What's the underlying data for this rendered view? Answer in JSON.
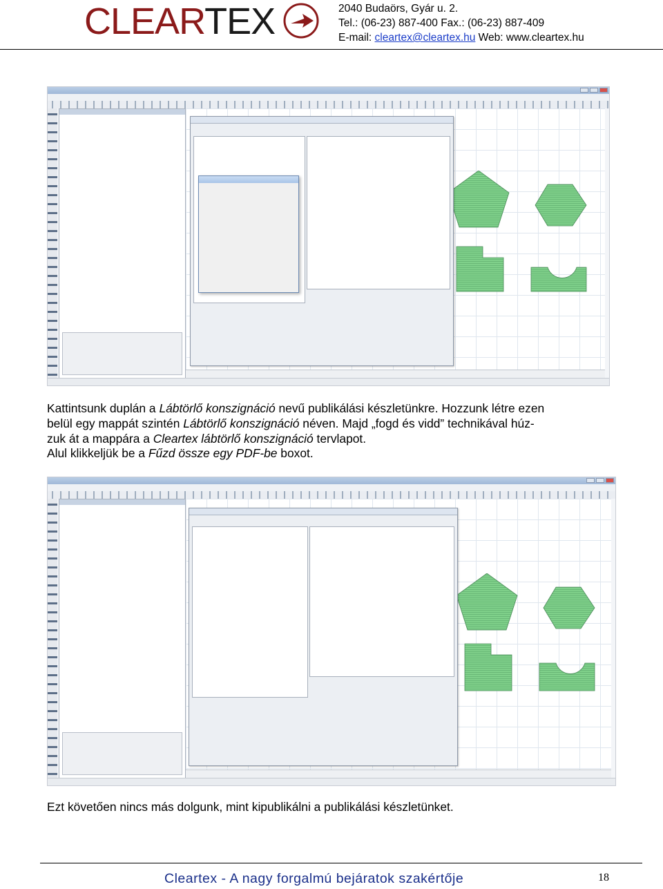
{
  "header": {
    "logo_left": "CLEAR",
    "logo_right": "TEX",
    "address": "2040 Budaörs, Gyár u. 2.",
    "phone": "Tel.: (06-23) 887-400  Fax.: (06-23) 887-409",
    "email_label": "E-mail: ",
    "email": "cleartex@cleartex.hu",
    "web": " Web: www.cleartex.hu",
    "colors": {
      "brand_red": "#8b1a1a",
      "link_blue": "#1a3cc8"
    }
  },
  "paragraph1": {
    "l1_a": "Kattintsunk duplán a ",
    "l1_b": "Lábtörlő konszignáció",
    "l1_c": " nevű publikálási készletünkre. Hozzunk létre ezen",
    "l2_a": "belül egy mappát szintén ",
    "l2_b": "Lábtörlő konszignáció",
    "l2_c": " néven. Majd „fogd és vidd” technikával húz-",
    "l3_a": "zuk át a mappára a ",
    "l3_b": "Cleartex lábtörlő konszignáció",
    "l3_c": " tervlapot.",
    "l4_a": "Alul klikkeljük be a ",
    "l4_b": "Fűzd össze egy PDF-be",
    "l4_c": " boxot."
  },
  "paragraph2": "Ezt követően nincs más dolgunk, mint kipublikálni a publikálási készletünket.",
  "footer": {
    "tagline": "Cleartex - A nagy forgalmú bejáratok szakértője",
    "page_number": "18"
  }
}
